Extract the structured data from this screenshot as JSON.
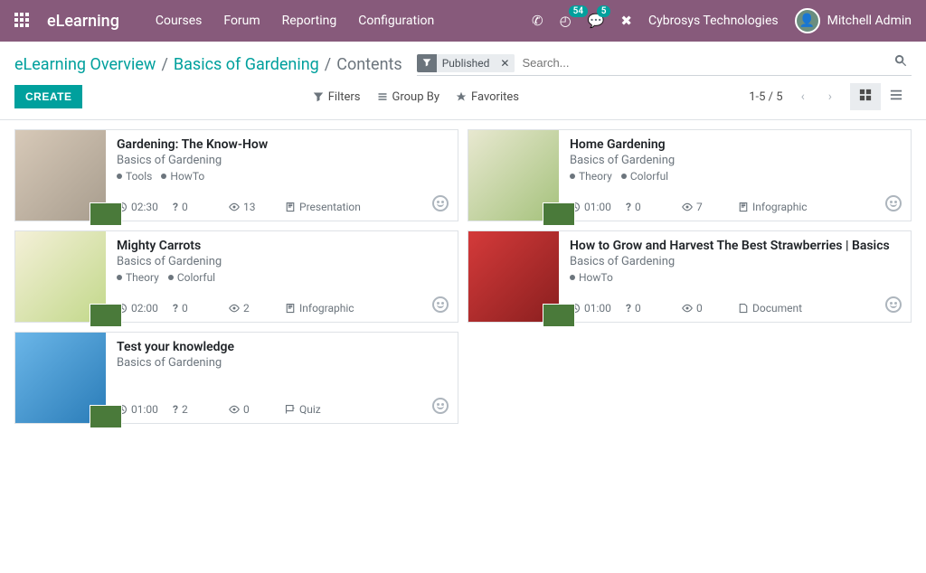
{
  "nav": {
    "brand": "eLearning",
    "menu": [
      "Courses",
      "Forum",
      "Reporting",
      "Configuration"
    ],
    "badge_timer": "54",
    "badge_chat": "5",
    "company": "Cybrosys Technologies",
    "user": "Mitchell Admin"
  },
  "breadcrumb": {
    "root": "eLearning Overview",
    "mid": "Basics of Gardening",
    "current": "Contents"
  },
  "search": {
    "facet_label": "Published",
    "placeholder": "Search..."
  },
  "buttons": {
    "create": "CREATE"
  },
  "toolbar": {
    "filters": "Filters",
    "groupby": "Group By",
    "favorites": "Favorites",
    "pager": "1-5 / 5"
  },
  "cards": [
    {
      "title": "Gardening: The Know-How",
      "sub": "Basics of Gardening",
      "tags": [
        "Tools",
        "HowTo"
      ],
      "duration": "02:30",
      "questions": "0",
      "views": "13",
      "type": "Presentation",
      "thumb_class": "th-a"
    },
    {
      "title": "Home Gardening",
      "sub": "Basics of Gardening",
      "tags": [
        "Theory",
        "Colorful"
      ],
      "duration": "01:00",
      "questions": "0",
      "views": "7",
      "type": "Infographic",
      "thumb_class": "th-c"
    },
    {
      "title": "Mighty Carrots",
      "sub": "Basics of Gardening",
      "tags": [
        "Theory",
        "Colorful"
      ],
      "duration": "02:00",
      "questions": "0",
      "views": "2",
      "type": "Infographic",
      "thumb_class": "th-b"
    },
    {
      "title": "How to Grow and Harvest The Best Strawberries | Basics",
      "sub": "Basics of Gardening",
      "tags": [
        "HowTo"
      ],
      "duration": "01:00",
      "questions": "0",
      "views": "0",
      "type": "Document",
      "thumb_class": "th-d"
    },
    {
      "title": "Test your knowledge",
      "sub": "Basics of Gardening",
      "tags": [],
      "duration": "01:00",
      "questions": "2",
      "views": "0",
      "type": "Quiz",
      "thumb_class": "th-e"
    }
  ]
}
